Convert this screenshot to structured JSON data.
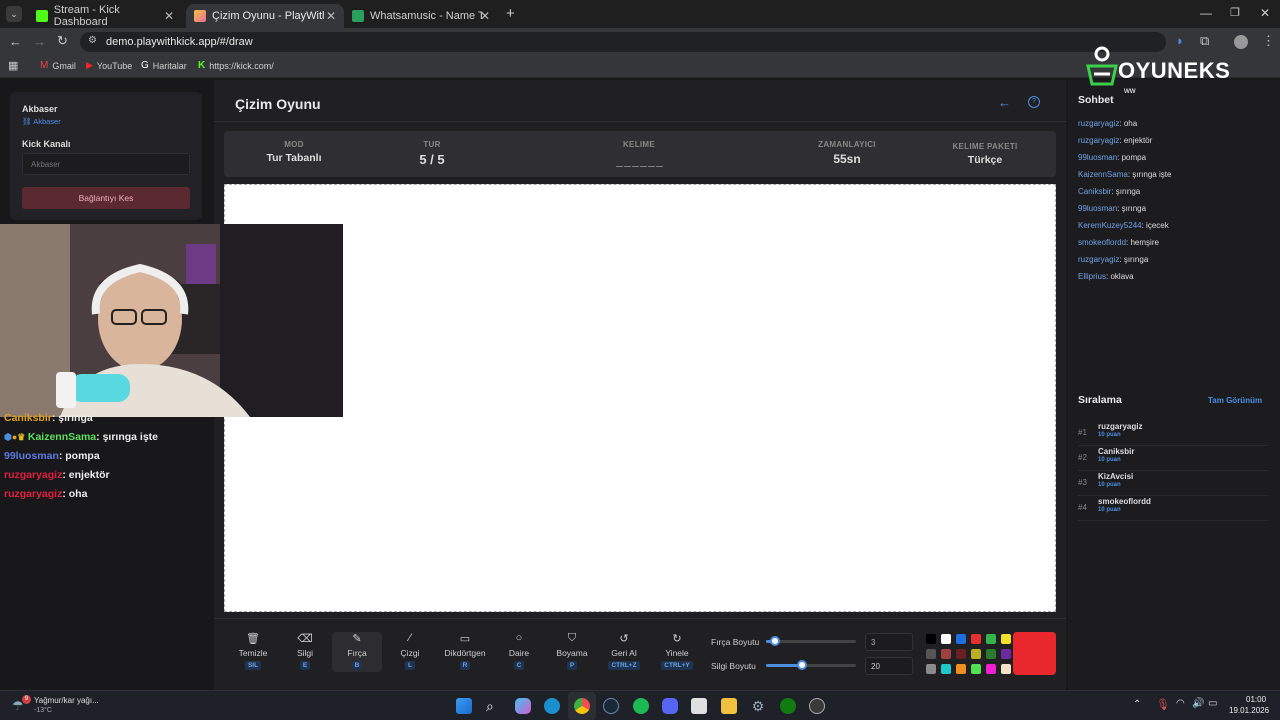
{
  "browser": {
    "tabs": [
      {
        "title": "Stream - Kick Dashboard",
        "active": false
      },
      {
        "title": "Çizim Oyunu - PlayWithKick.AP",
        "active": true
      },
      {
        "title": "Whatsamusic - Name That Tun",
        "active": false
      }
    ],
    "url": "demo.playwithkick.app/#/draw",
    "bookmarks": [
      "Gmail",
      "YouTube",
      "Haritalar",
      "https://kick.com/"
    ]
  },
  "sidebar": {
    "user_name": "Akbaser",
    "user_link": "Akbaser",
    "channel_label": "Kick Kanalı",
    "channel_placeholder": "Akbaser",
    "disconnect_label": "Bağlantıyı Kes"
  },
  "game": {
    "title": "Çizim Oyunu",
    "stats": [
      {
        "label": "MOD",
        "value": "Tur Tabanlı"
      },
      {
        "label": "TUR",
        "value": "5 / 5"
      },
      {
        "label": "KELIME",
        "value": "_ _ _ _ _ _"
      },
      {
        "label": "ZAMANLAYICI",
        "value": "55sn"
      },
      {
        "label": "KELIME PAKETI",
        "value": "Türkçe"
      }
    ]
  },
  "tools": [
    {
      "label": "Temizle",
      "key": "SIL",
      "icon": "trash-icon",
      "active": false
    },
    {
      "label": "Silgi",
      "key": "E",
      "icon": "eraser-icon",
      "active": false
    },
    {
      "label": "Fırça",
      "key": "B",
      "icon": "brush-icon",
      "active": true
    },
    {
      "label": "Çizgi",
      "key": "L",
      "icon": "line-icon",
      "active": false
    },
    {
      "label": "Dikdörtgen",
      "key": "R",
      "icon": "rectangle-icon",
      "active": false
    },
    {
      "label": "Daire",
      "key": "C",
      "icon": "circle-icon",
      "active": false
    },
    {
      "label": "Boyama",
      "key": "P",
      "icon": "bucket-icon",
      "active": false
    },
    {
      "label": "Geri Al",
      "key": "CTRL+Z",
      "icon": "undo-icon",
      "active": false
    },
    {
      "label": "Yinele",
      "key": "CTRL+Y",
      "icon": "redo-icon",
      "active": false
    }
  ],
  "brush": {
    "brush_size_label": "Fırça Boyutu",
    "brush_size_value": "3",
    "eraser_size_label": "Silgi Boyutu",
    "eraser_size_value": "20",
    "brush_slider_fraction": 0.1,
    "eraser_slider_fraction": 0.4,
    "palette": [
      "#000000",
      "#ffffff",
      "#1e6fe0",
      "#e53030",
      "#34b44a",
      "#f2e02a",
      "#555555",
      "#a04040",
      "#6a2020",
      "#b8b020",
      "#2a7a30",
      "#6a2aa0",
      "#8a8a8a",
      "#1ec8c8",
      "#f09020",
      "#50e050",
      "#f020d0",
      "#f5e0c8"
    ],
    "selected_color": "#e8282d"
  },
  "chat": {
    "title": "Sohbet",
    "messages": [
      {
        "user": "ruzgaryagiz",
        "text": "oha"
      },
      {
        "user": "ruzgaryagiz",
        "text": "enjektör"
      },
      {
        "user": "99luosman",
        "text": "pompa"
      },
      {
        "user": "KaizennSama",
        "text": "şırınga işte"
      },
      {
        "user": "Caniksbir",
        "text": "şırınga"
      },
      {
        "user": "99luosman",
        "text": "şırınga"
      },
      {
        "user": "KeremKuzey5244",
        "text": "içecek"
      },
      {
        "user": "smokeoflordd",
        "text": "hemşire"
      },
      {
        "user": "ruzgaryagiz",
        "text": "şırınga"
      },
      {
        "user": "Elliprius",
        "text": "oklava"
      }
    ]
  },
  "ranking": {
    "title": "Sıralama",
    "full_view_label": "Tam Görünüm",
    "entries": [
      {
        "rank": "#1",
        "name": "ruzgaryagiz",
        "points": "10 puan"
      },
      {
        "rank": "#2",
        "name": "Caniksbir",
        "points": "10 puan"
      },
      {
        "rank": "#3",
        "name": "KizAvcisi",
        "points": "10 puan"
      },
      {
        "rank": "#4",
        "name": "smokeoflordd",
        "points": "10 puan"
      }
    ]
  },
  "overlay": {
    "logo_text": "OYUNEKS",
    "logo_sub": "ww",
    "stream_chat": [
      {
        "user": "Caniksbir",
        "text": ": şırınga",
        "color": "#e0a020"
      },
      {
        "user": "KaizennSama",
        "text": ": şırınga işte",
        "color": "#5ce05c"
      },
      {
        "user": "99luosman",
        "text": ": pompa",
        "color": "#5a7ae0"
      },
      {
        "user": "ruzgaryagiz",
        "text": ": enjektör",
        "color": "#e02040"
      },
      {
        "user": "ruzgaryagiz",
        "text": ": oha",
        "color": "#e02040"
      }
    ]
  },
  "taskbar": {
    "weather_title": "Yağmur/kar yağı...",
    "weather_temp": "-13°C",
    "weather_badge": "9",
    "time": "01:00",
    "date": "19.01.2026"
  }
}
